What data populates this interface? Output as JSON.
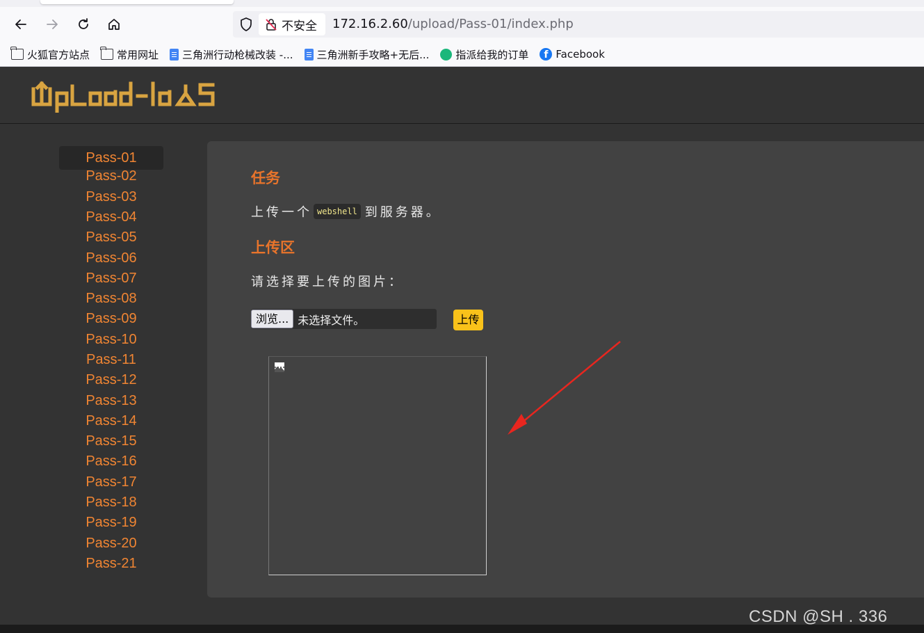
{
  "browser": {
    "url_host": "172.16.2.60",
    "url_path": "/upload/Pass-01/index.php",
    "security_label": "不安全",
    "bookmarks": [
      {
        "label": "火狐官方站点",
        "icon": "folder-icon"
      },
      {
        "label": "常用网址",
        "icon": "folder-icon"
      },
      {
        "label": "三角洲行动枪械改装 -...",
        "icon": "doc-icon"
      },
      {
        "label": "三角洲新手攻略+无后...",
        "icon": "doc-icon"
      },
      {
        "label": "指派给我的订单",
        "icon": "green-bolt-icon"
      },
      {
        "label": "Facebook",
        "icon": "facebook-icon"
      }
    ]
  },
  "sidebar": {
    "items": [
      "Pass-01",
      "Pass-02",
      "Pass-03",
      "Pass-04",
      "Pass-05",
      "Pass-06",
      "Pass-07",
      "Pass-08",
      "Pass-09",
      "Pass-10",
      "Pass-11",
      "Pass-12",
      "Pass-13",
      "Pass-14",
      "Pass-15",
      "Pass-16",
      "Pass-17",
      "Pass-18",
      "Pass-19",
      "Pass-20",
      "Pass-21"
    ],
    "active": "Pass-01"
  },
  "main": {
    "task_heading": "任务",
    "task_prefix": "上传一个",
    "task_code": "webshell",
    "task_suffix": "到服务器。",
    "upload_heading": "上传区",
    "select_prompt": "请选择要上传的图片：",
    "browse_label": "浏览...",
    "no_file_label": "未选择文件。",
    "upload_button": "上传"
  },
  "watermark": "CSDN @SH      . 336",
  "colors": {
    "accent_orange": "#f08533",
    "heading_orange": "#e8742b",
    "upload_yellow": "#f9c21a",
    "logo_gold": "#d9a441",
    "arrow_red": "#e8261f"
  }
}
